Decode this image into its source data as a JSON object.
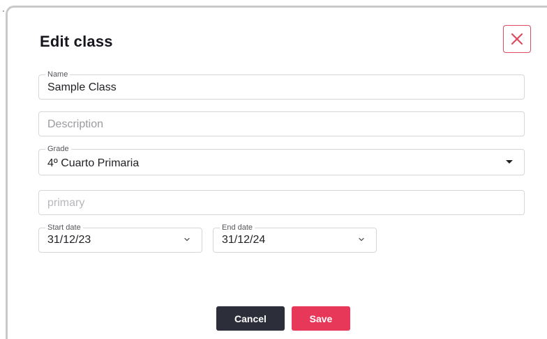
{
  "dialog": {
    "title": "Edit class",
    "close_icon": "close-x-icon"
  },
  "form": {
    "name": {
      "label": "Name",
      "value": "Sample Class"
    },
    "description": {
      "placeholder": "Description",
      "value": ""
    },
    "grade": {
      "label": "Grade",
      "value": "4º Cuarto Primaria"
    },
    "level": {
      "placeholder": "primary",
      "value": ""
    },
    "start_date": {
      "label": "Start date",
      "value": "31/12/23"
    },
    "end_date": {
      "label": "End date",
      "value": "31/12/24"
    }
  },
  "actions": {
    "cancel_label": "Cancel",
    "save_label": "Save"
  },
  "colors": {
    "accent": "#e8385a",
    "dark_button": "#2c2f3a",
    "close_border": "#e04a5f"
  }
}
